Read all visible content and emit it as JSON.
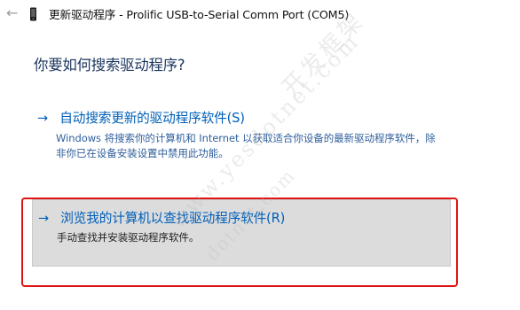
{
  "window": {
    "title": "更新驱动程序 - Prolific USB-to-Serial Comm Port (COM5)"
  },
  "page": {
    "question": "你要如何搜索驱动程序?"
  },
  "options": {
    "auto": {
      "label": "自动搜索更新的驱动程序软件(S)",
      "description_line1": "Windows 将搜索你的计算机和 Internet 以获取适合你设备的最新驱动程序软件，除",
      "description_line2": "非你已在设备安装设置中禁用此功能。"
    },
    "browse": {
      "label": "浏览我的计算机以查找驱动程序软件(R)",
      "description_line1": "手动查找并安装驱动程序软件。"
    }
  },
  "icons": {
    "back": "back-arrow-icon",
    "device": "device-icon",
    "arrow": "right-arrow-icon"
  },
  "colors": {
    "link": "#005fb8",
    "heading": "#1b355e",
    "highlight_border": "#e11414",
    "selected_background": "#dcdcdc"
  },
  "watermark": {
    "text_cn": "开发框架",
    "text_url": "www.yesdotnet.com",
    "text_url2": "dotnet.com"
  }
}
